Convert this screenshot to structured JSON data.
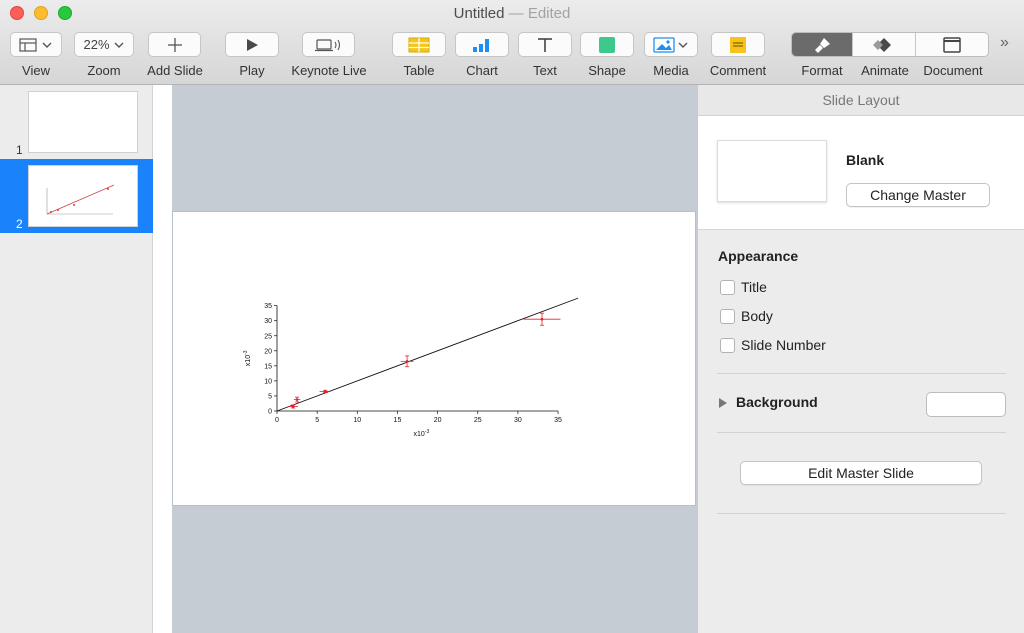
{
  "window": {
    "title": "Untitled",
    "edited": "— Edited"
  },
  "toolbar": {
    "view_label": "View",
    "zoom_value": "22%",
    "zoom_label": "Zoom",
    "add_slide_label": "Add Slide",
    "play_label": "Play",
    "keynote_live_label": "Keynote Live",
    "table_label": "Table",
    "chart_label": "Chart",
    "text_label": "Text",
    "shape_label": "Shape",
    "media_label": "Media",
    "comment_label": "Comment",
    "format_label": "Format",
    "animate_label": "Animate",
    "document_label": "Document",
    "overflow_icon": "»"
  },
  "navigator": {
    "slides": [
      {
        "number": "1",
        "selected": false
      },
      {
        "number": "2",
        "selected": true
      }
    ]
  },
  "inspector": {
    "header": "Slide Layout",
    "master_name": "Blank",
    "change_master_label": "Change Master",
    "appearance_title": "Appearance",
    "checkboxes": [
      {
        "label": "Title",
        "checked": false
      },
      {
        "label": "Body",
        "checked": false
      },
      {
        "label": "Slide Number",
        "checked": false
      }
    ],
    "background_label": "Background",
    "background_color": "#ffffff",
    "edit_master_label": "Edit Master Slide"
  },
  "chart_data": {
    "type": "scatter",
    "x": [
      2.0,
      2.5,
      6.0,
      16.2,
      33.0
    ],
    "y": [
      1.5,
      3.8,
      6.5,
      16.5,
      30.5
    ],
    "x_err": [
      0.6,
      0.4,
      0.7,
      0.8,
      2.3
    ],
    "y_err": [
      0.5,
      0.8,
      0.4,
      1.8,
      2.0
    ],
    "fit_line": {
      "x": [
        0,
        37.5
      ],
      "y": [
        0,
        37.5
      ]
    },
    "xlim": [
      0,
      35
    ],
    "ylim": [
      0,
      35
    ],
    "xticks": [
      "0",
      "5",
      "10",
      "15",
      "20",
      "25",
      "30",
      "35"
    ],
    "yticks": [
      "0",
      "5",
      "10",
      "15",
      "20",
      "25",
      "30",
      "35"
    ],
    "xlabel": "x10",
    "xlabel_exp": "-3",
    "ylabel": "x10",
    "ylabel_exp": "-3",
    "point_color": "#e8202a",
    "line_color": "#111111"
  }
}
